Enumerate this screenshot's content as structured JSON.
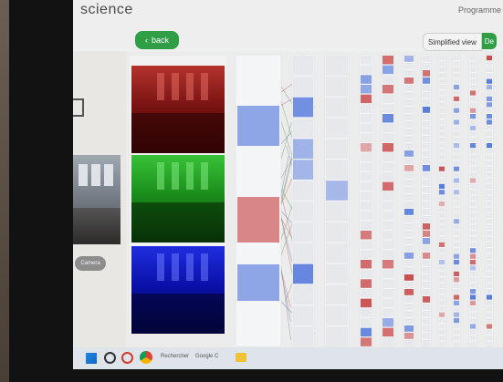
{
  "header": {
    "title": "science",
    "right_text": "Programme"
  },
  "back_button": {
    "label": "back",
    "icon": "chevron-left-icon"
  },
  "view_toggle": {
    "simplified_label": "Simplified view",
    "detailed_label": "De"
  },
  "input_panel": {
    "caption": "Camera"
  },
  "channels": [
    "red",
    "green",
    "blue"
  ],
  "taskbar": {
    "search_text": "Rechercher",
    "browser_text": "Google C",
    "icons": [
      "windows-icon",
      "search-icon",
      "cortana-icon",
      "chrome-icon",
      "folder-icon"
    ]
  },
  "colors": {
    "accent": "#2f9e47",
    "activation_high": "#c22a2a",
    "activation_low": "#3a64d8"
  }
}
